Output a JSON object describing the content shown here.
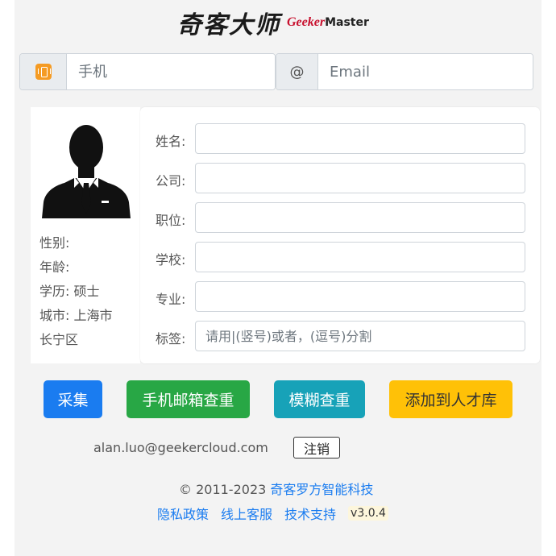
{
  "logo": {
    "cn": "奇客大师",
    "en_red": "Geeker",
    "en_dark": "Master"
  },
  "contact": {
    "phone_placeholder": "手机",
    "email_symbol": "@",
    "email_placeholder": "Email"
  },
  "profile": {
    "gender_label": "性别:",
    "age_label": "年龄:",
    "education_label": "学历:",
    "education_value": "硕士",
    "city_label": "城市:",
    "city_value": "上海市",
    "district": "长宁区"
  },
  "form": {
    "name_label": "姓名:",
    "company_label": "公司:",
    "position_label": "职位:",
    "school_label": "学校:",
    "major_label": "专业:",
    "tags_label": "标签:",
    "tags_placeholder": "请用|(竖号)或者，(逗号)分割"
  },
  "buttons": {
    "collect": "采集",
    "phone_email_dedupe": "手机邮箱查重",
    "fuzzy_dedupe": "模糊查重",
    "add_to_pool": "添加到人才库"
  },
  "account": {
    "email": "alan.luo@geekercloud.com",
    "logout": "注销"
  },
  "footer": {
    "copyright": "© 2011-2023",
    "company": "奇客罗方智能科技",
    "privacy": "隐私政策",
    "support_online": "线上客服",
    "tech_support": "技术支持",
    "version": "v3.0.4"
  },
  "colors": {
    "primary": "#1a7cf0",
    "success": "#28a745",
    "info": "#17a2b8",
    "warning": "#ffc107",
    "brand_red": "#c8102e"
  }
}
